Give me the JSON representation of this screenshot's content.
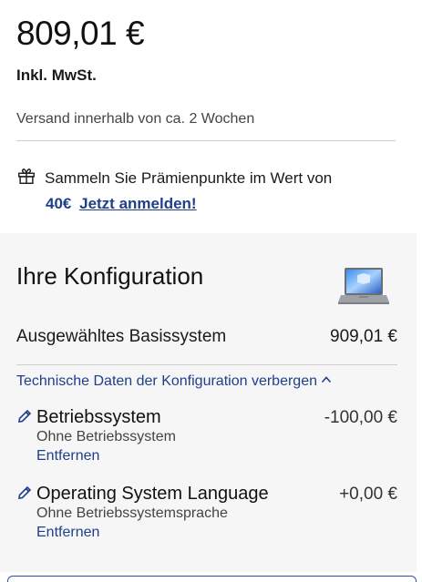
{
  "price": {
    "amount": "809,01 €",
    "vat_note": "Inkl. MwSt.",
    "shipping": "Versand innerhalb von ca. 2 Wochen"
  },
  "rewards": {
    "text": "Sammeln Sie Prämienpunkte im Wert von",
    "amount": "40€",
    "link_label": "Jetzt anmelden!"
  },
  "configuration": {
    "title": "Ihre Konfiguration",
    "base_system": {
      "label": "Ausgewähltes Basissystem",
      "price": "909,01 €"
    },
    "tech_link": "Technische Daten der Konfiguration verbergen",
    "items": [
      {
        "name": "Betriebssystem",
        "price": "-100,00 €",
        "selection": "Ohne Betriebssystem",
        "remove_label": "Entfernen"
      },
      {
        "name": "Operating System Language",
        "price": "+0,00 €",
        "selection": "Ohne Betriebssystemsprache",
        "remove_label": "Entfernen"
      }
    ]
  },
  "colors": {
    "link": "#1f3f8c",
    "panel_bg": "#f6f6f6",
    "divider": "#cfcfcf"
  }
}
